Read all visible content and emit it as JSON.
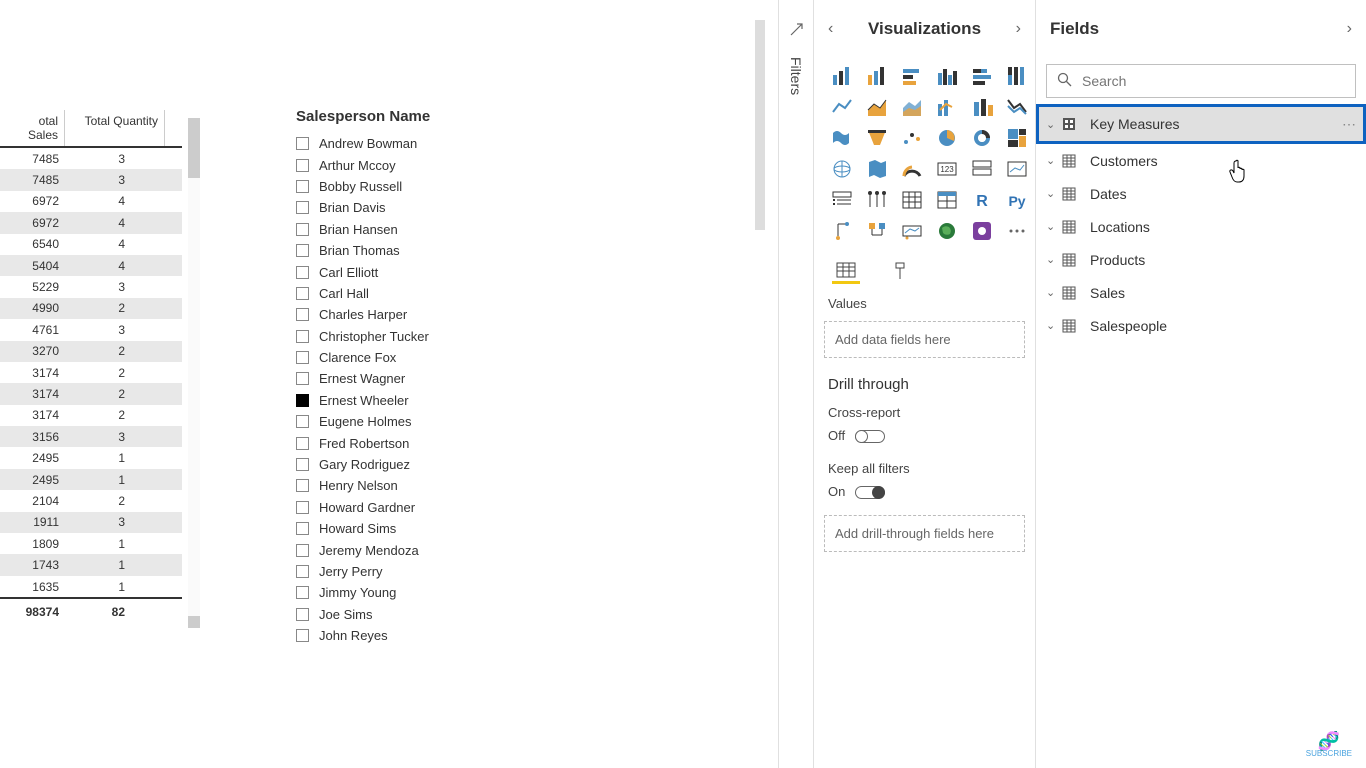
{
  "table": {
    "columns": {
      "sales": "otal Sales",
      "qty": "Total Quantity"
    },
    "rows": [
      {
        "sales": "7485",
        "qty": "3"
      },
      {
        "sales": "7485",
        "qty": "3"
      },
      {
        "sales": "6972",
        "qty": "4"
      },
      {
        "sales": "6972",
        "qty": "4"
      },
      {
        "sales": "6540",
        "qty": "4"
      },
      {
        "sales": "5404",
        "qty": "4"
      },
      {
        "sales": "5229",
        "qty": "3"
      },
      {
        "sales": "4990",
        "qty": "2"
      },
      {
        "sales": "4761",
        "qty": "3"
      },
      {
        "sales": "3270",
        "qty": "2"
      },
      {
        "sales": "3174",
        "qty": "2"
      },
      {
        "sales": "3174",
        "qty": "2"
      },
      {
        "sales": "3174",
        "qty": "2"
      },
      {
        "sales": "3156",
        "qty": "3"
      },
      {
        "sales": "2495",
        "qty": "1"
      },
      {
        "sales": "2495",
        "qty": "1"
      },
      {
        "sales": "2104",
        "qty": "2"
      },
      {
        "sales": "1911",
        "qty": "3"
      },
      {
        "sales": "1809",
        "qty": "1"
      },
      {
        "sales": "1743",
        "qty": "1"
      },
      {
        "sales": "1635",
        "qty": "1"
      }
    ],
    "footer": {
      "sales": "98374",
      "qty": "82"
    }
  },
  "slicer": {
    "title": "Salesperson Name",
    "items": [
      {
        "name": "Andrew Bowman",
        "checked": false
      },
      {
        "name": "Arthur Mccoy",
        "checked": false
      },
      {
        "name": "Bobby Russell",
        "checked": false
      },
      {
        "name": "Brian Davis",
        "checked": false
      },
      {
        "name": "Brian Hansen",
        "checked": false
      },
      {
        "name": "Brian Thomas",
        "checked": false
      },
      {
        "name": "Carl Elliott",
        "checked": false
      },
      {
        "name": "Carl Hall",
        "checked": false
      },
      {
        "name": "Charles Harper",
        "checked": false
      },
      {
        "name": "Christopher Tucker",
        "checked": false
      },
      {
        "name": "Clarence Fox",
        "checked": false
      },
      {
        "name": "Ernest Wagner",
        "checked": false
      },
      {
        "name": "Ernest Wheeler",
        "checked": true
      },
      {
        "name": "Eugene Holmes",
        "checked": false
      },
      {
        "name": "Fred Robertson",
        "checked": false
      },
      {
        "name": "Gary Rodriguez",
        "checked": false
      },
      {
        "name": "Henry Nelson",
        "checked": false
      },
      {
        "name": "Howard Gardner",
        "checked": false
      },
      {
        "name": "Howard Sims",
        "checked": false
      },
      {
        "name": "Jeremy Mendoza",
        "checked": false
      },
      {
        "name": "Jerry Perry",
        "checked": false
      },
      {
        "name": "Jimmy Young",
        "checked": false
      },
      {
        "name": "Joe Sims",
        "checked": false
      },
      {
        "name": "John Reyes",
        "checked": false
      }
    ]
  },
  "filters": {
    "label": "Filters"
  },
  "viz": {
    "title": "Visualizations",
    "values_label": "Values",
    "values_placeholder": "Add data fields here",
    "drill_title": "Drill through",
    "cross_report_label": "Cross-report",
    "cross_report_value": "Off",
    "keep_filters_label": "Keep all filters",
    "keep_filters_value": "On",
    "drill_placeholder": "Add drill-through fields here"
  },
  "fields": {
    "title": "Fields",
    "search_placeholder": "Search",
    "tables": [
      {
        "name": "Key Measures",
        "type": "measure",
        "highlighted": true
      },
      {
        "name": "Customers",
        "type": "table"
      },
      {
        "name": "Dates",
        "type": "table"
      },
      {
        "name": "Locations",
        "type": "table"
      },
      {
        "name": "Products",
        "type": "table"
      },
      {
        "name": "Sales",
        "type": "table"
      },
      {
        "name": "Salespeople",
        "type": "table"
      }
    ]
  },
  "logo": "SUBSCRIBE"
}
